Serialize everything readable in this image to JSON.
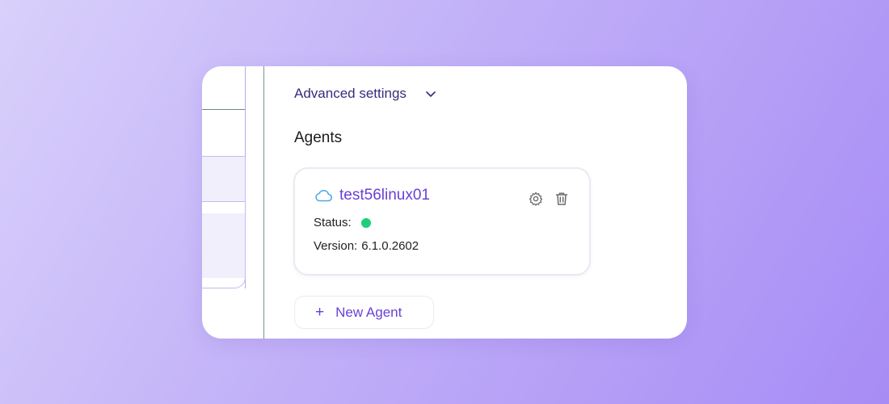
{
  "advanced_settings": {
    "label": "Advanced settings",
    "icon": "chevron-down-icon"
  },
  "agents": {
    "title": "Agents",
    "items": [
      {
        "name": "test56linux01",
        "icon": "cloud-icon",
        "status_label": "Status:",
        "status_color": "#1fce7a",
        "version_label": "Version:",
        "version": "6.1.0.2602"
      }
    ]
  },
  "new_agent": {
    "plus": "+",
    "label": "New Agent"
  },
  "colors": {
    "accent": "#6b3fd6",
    "heading": "#3b2a7a",
    "status_online": "#1fce7a"
  }
}
